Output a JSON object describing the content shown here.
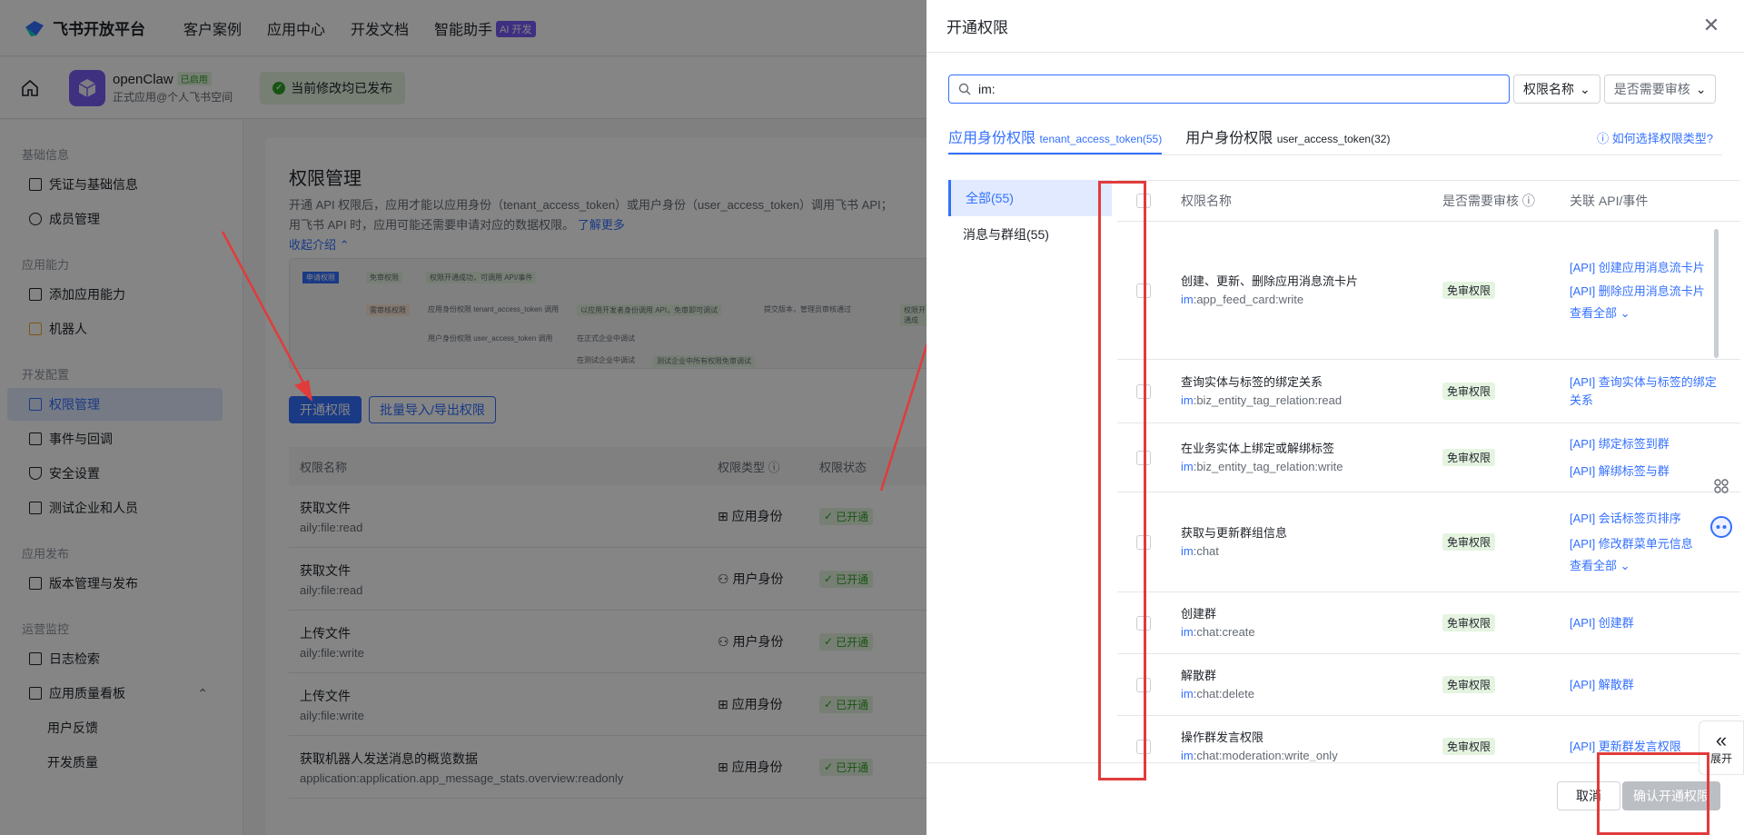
{
  "topnav": {
    "brand": "飞书开放平台",
    "links": [
      "客户案例",
      "应用中心",
      "开发文档",
      "智能助手"
    ],
    "ai_badge": "AI 开发"
  },
  "app": {
    "name": "openClaw",
    "status_tag": "已启用",
    "subtitle": "正式应用@个人飞书空间",
    "publish_status": "当前修改均已发布"
  },
  "sidebar": {
    "sections": [
      {
        "title": "基础信息",
        "items": [
          "凭证与基础信息",
          "成员管理"
        ]
      },
      {
        "title": "应用能力",
        "items": [
          "添加应用能力",
          "机器人"
        ]
      },
      {
        "title": "开发配置",
        "items": [
          "权限管理",
          "事件与回调",
          "安全设置",
          "测试企业和人员"
        ]
      },
      {
        "title": "应用发布",
        "items": [
          "版本管理与发布"
        ]
      },
      {
        "title": "运营监控",
        "items": [
          "日志检索",
          "应用质量看板",
          "用户反馈",
          "开发质量"
        ]
      }
    ]
  },
  "main": {
    "title": "权限管理",
    "desc1": "开通 API 权限后，应用才能以应用身份（tenant_access_token）或用户身份（user_access_token）调用飞书 API；",
    "desc2": "用飞书 API 时，应用可能还需要申请对应的数据权限。",
    "learn_more": "了解更多",
    "collapse": "收起介绍",
    "diagram": {
      "a": "申请权限",
      "b": "免审权限",
      "c": "权限开通成功，可调用 API/事件",
      "d": "需审核权限",
      "e": "应用身份权限",
      "e2": "tenant_access_token 调用",
      "f": "以应用开发者身份调用 API，免审即可调试",
      "g": "提交版本，管理员审核通过",
      "h": "权限开通成",
      "i": "用户身份权限",
      "i2": "user_access_token 调用",
      "j": "在正式企业中调试",
      "k": "在测试企业中调试",
      "l": "测试企业中所有权限免审调试"
    },
    "btn_open": "开通权限",
    "btn_batch": "批量导入/导出权限",
    "headers": [
      "权限名称",
      "权限类型",
      "权限状态"
    ],
    "rows": [
      {
        "name": "获取文件",
        "code": "aily:file:read",
        "type": "应用身份",
        "status": "已开通"
      },
      {
        "name": "获取文件",
        "code": "aily:file:read",
        "type": "用户身份",
        "status": "已开通"
      },
      {
        "name": "上传文件",
        "code": "aily:file:write",
        "type": "用户身份",
        "status": "已开通"
      },
      {
        "name": "上传文件",
        "code": "aily:file:write",
        "type": "应用身份",
        "status": "已开通"
      },
      {
        "name": "获取机器人发送消息的概览数据",
        "code": "application:application.app_message_stats.overview:readonly",
        "type": "应用身份",
        "status": "已开通"
      }
    ]
  },
  "drawer": {
    "title": "开通权限",
    "search_value": "im:",
    "filter1": "权限名称",
    "filter2": "是否需要审核",
    "tab1": "应用身份权限",
    "tab1_token": "tenant_access_token(55)",
    "tab2": "用户身份权限",
    "tab2_token": "user_access_token(32)",
    "howto": "如何选择权限类型?",
    "cats": [
      "全部(55)",
      "消息与群组(55)"
    ],
    "headers": {
      "name": "权限名称",
      "audit": "是否需要审核",
      "api": "关联 API/事件"
    },
    "rows": [
      {
        "name": "创建、更新、删除应用消息流卡片",
        "prefix": "im",
        "code": ":app_feed_card:write",
        "audit": "免审权限",
        "apis": [
          "[API] 创建应用消息流卡片",
          "[API] 删除应用消息流卡片"
        ],
        "more": "查看全部"
      },
      {
        "name": "查询实体与标签的绑定关系",
        "prefix": "im",
        "code": ":biz_entity_tag_relation:read",
        "audit": "免审权限",
        "apis": [
          "[API] 查询实体与标签的绑定关系"
        ]
      },
      {
        "name": "在业务实体上绑定或解绑标签",
        "prefix": "im",
        "code": ":biz_entity_tag_relation:write",
        "audit": "免审权限",
        "apis": [
          "[API] 绑定标签到群",
          "[API] 解绑标签与群"
        ]
      },
      {
        "name": "获取与更新群组信息",
        "prefix": "im",
        "code": ":chat",
        "audit": "免审权限",
        "apis": [
          "[API] 会话标签页排序",
          "[API] 修改群菜单元信息"
        ],
        "more": "查看全部"
      },
      {
        "name": "创建群",
        "prefix": "im",
        "code": ":chat:create",
        "audit": "免审权限",
        "apis": [
          "[API] 创建群"
        ]
      },
      {
        "name": "解散群",
        "prefix": "im",
        "code": ":chat:delete",
        "audit": "免审权限",
        "apis": [
          "[API] 解散群"
        ]
      },
      {
        "name": "操作群发言权限",
        "prefix": "im",
        "code": ":chat:moderation:write_only",
        "audit": "免审权限",
        "apis": [
          "[API] 更新群发言权限"
        ]
      }
    ],
    "cancel": "取消",
    "confirm": "确认开通权限",
    "expand": "展开"
  }
}
